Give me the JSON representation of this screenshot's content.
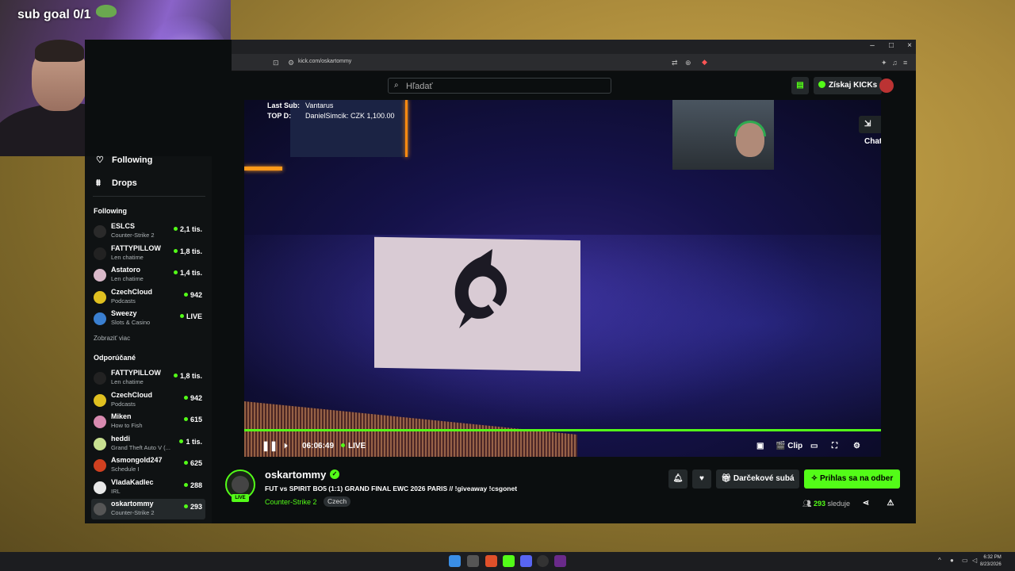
{
  "overlay": {
    "sub_goal": "sub goal 0/1"
  },
  "browser": {
    "url": "kick.com/oskartommy",
    "window_controls": [
      "–",
      "□",
      "×"
    ]
  },
  "header": {
    "search_placeholder": "Hľadať",
    "kicks_label": "Získaj KICKs"
  },
  "sidebar": {
    "nav": [
      {
        "label": "Following",
        "icon": "heart-icon"
      },
      {
        "label": "Drops",
        "icon": "drops-icon"
      }
    ],
    "following_title": "Following",
    "following": [
      {
        "name": "ESLCS",
        "category": "Counter-Strike 2",
        "viewers": "2,1 tis.",
        "color": "#2a2a2a"
      },
      {
        "name": "FATTYPILLOW",
        "category": "Len chatime",
        "viewers": "1,8 tis.",
        "color": "#222"
      },
      {
        "name": "Astatoro",
        "category": "Len chatime",
        "viewers": "1,4 tis.",
        "color": "#d9b9c9"
      },
      {
        "name": "CzechCloud",
        "category": "Podcasts",
        "viewers": "942",
        "color": "#e0c020"
      },
      {
        "name": "Sweezy",
        "category": "Slots & Casino",
        "viewers": "LIVE",
        "color": "#3a7fd0"
      }
    ],
    "show_more": "Zobraziť viac",
    "recommended_title": "Odporúčané",
    "recommended": [
      {
        "name": "FATTYPILLOW",
        "category": "Len chatime",
        "viewers": "1,8 tis.",
        "color": "#222"
      },
      {
        "name": "CzechCloud",
        "category": "Podcasts",
        "viewers": "942",
        "color": "#e0c020"
      },
      {
        "name": "Miken",
        "category": "How to Fish",
        "viewers": "615",
        "color": "#d88ab0"
      },
      {
        "name": "heddi",
        "category": "Grand Theft Auto V (...",
        "viewers": "1 tis.",
        "color": "#c8e090"
      },
      {
        "name": "Asmongold247",
        "category": "Schedule I",
        "viewers": "625",
        "color": "#d04020"
      },
      {
        "name": "VladaKadlec",
        "category": "IRL",
        "viewers": "288",
        "color": "#e8e8e8"
      },
      {
        "name": "oskartommy",
        "category": "Counter-Strike 2",
        "viewers": "293",
        "color": "#555"
      }
    ]
  },
  "player": {
    "last_sub_label": "Last Sub:",
    "last_sub_value": "Vantarus",
    "top_d_label": "TOP D:",
    "top_d_value": "DanielSimcik: CZK 1,100.00",
    "chat_label": "Chat",
    "time": "06:06:49",
    "live_label": "LIVE",
    "clip_label": "Clip"
  },
  "stream": {
    "name": "oskartommy",
    "live_badge": "LIVE",
    "title": "FUT vs SPIRIT BO5 (1:1) GRAND FINAL EWC 2026 PARIS  // !giveaway !csgonet",
    "category": "Counter-Strike 2",
    "tag": "Czech",
    "gift_label": "Darčekové subá",
    "subscribe_label": "Prihlas sa na odber",
    "viewers": "293",
    "viewers_suffix": "sleduje"
  },
  "taskbar": {
    "time": "6:32 PM",
    "date": "8/23/2026"
  },
  "colors": {
    "accent": "#53fc18",
    "bg": "#0b0e0f",
    "panel": "#24292b"
  }
}
